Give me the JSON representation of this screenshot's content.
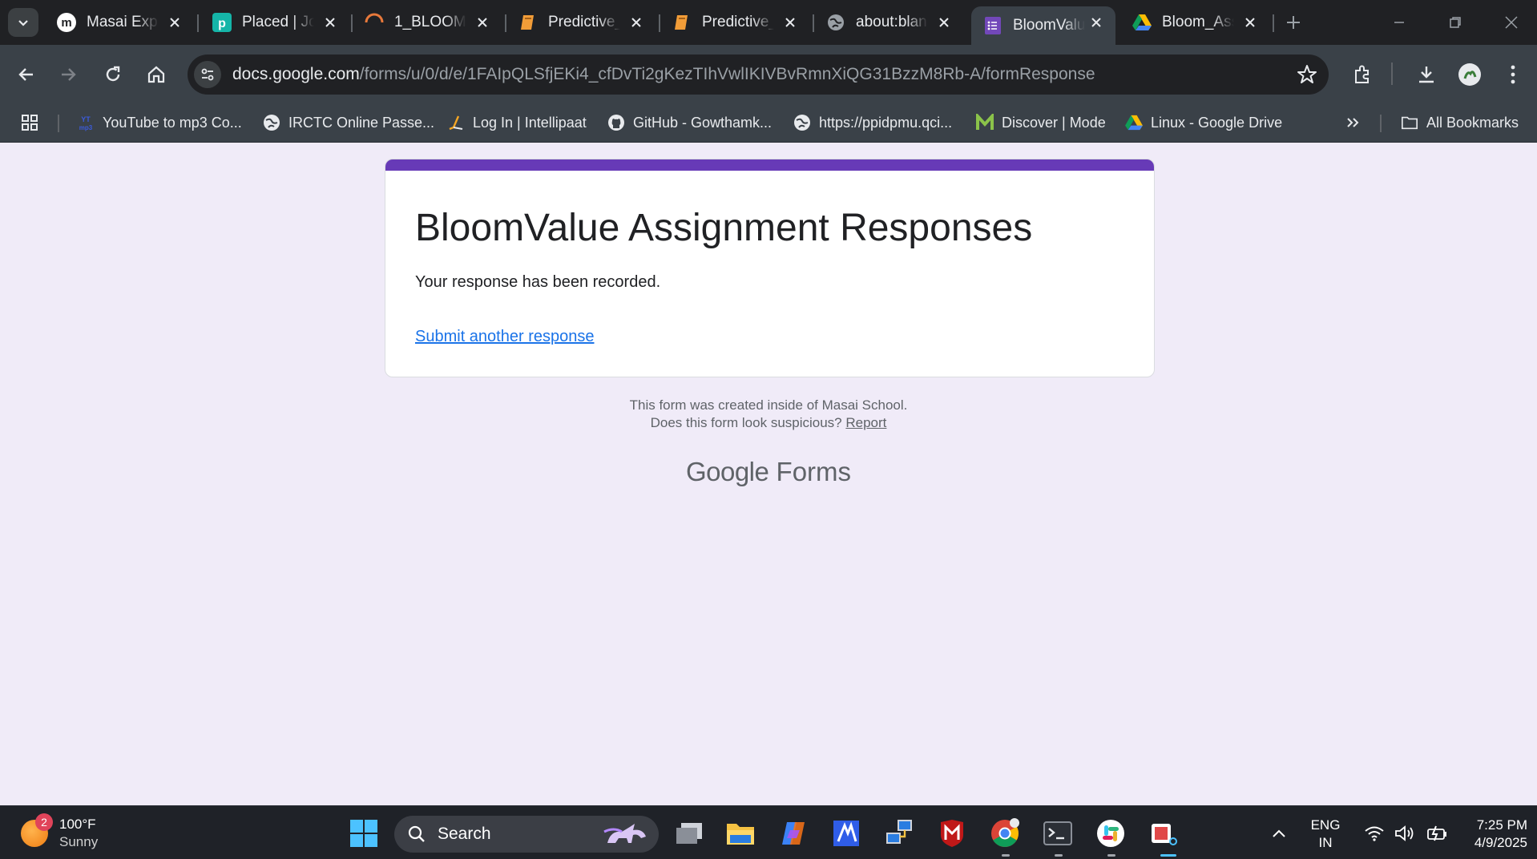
{
  "tabs": [
    {
      "title": "Masai Expe",
      "icon": "masai-icon"
    },
    {
      "title": "Placed | Jol",
      "icon": "placed-icon"
    },
    {
      "title": "1_BLOOM_",
      "icon": "loading-spinner-icon"
    },
    {
      "title": "Predictive_",
      "icon": "notebook-icon"
    },
    {
      "title": "Predictive_",
      "icon": "notebook-icon"
    },
    {
      "title": "about:blan",
      "icon": "globe-icon"
    },
    {
      "title": "BloomValu",
      "icon": "google-forms-icon",
      "active": true
    },
    {
      "title": "Bloom_Ass",
      "icon": "google-drive-icon"
    }
  ],
  "omnibox": {
    "host": "docs.google.com",
    "path": "/forms/u/0/d/e/1FAIpQLSfjEKi4_cfDvTi2gKezTIhVwlIKIVBvRmnXiQG31BzzM8Rb-A/formResponse"
  },
  "bookmarks": [
    {
      "label": "YouTube to mp3 Co...",
      "icon": "ytmp3-icon"
    },
    {
      "label": "IRCTC Online Passe...",
      "icon": "globe-icon"
    },
    {
      "label": "Log In | Intellipaat",
      "icon": "intellipaat-icon"
    },
    {
      "label": "GitHub - Gowthamk...",
      "icon": "github-icon"
    },
    {
      "label": "https://ppidpmu.qci...",
      "icon": "globe-icon"
    },
    {
      "label": "Discover | Mode",
      "icon": "mode-icon"
    },
    {
      "label": "Linux - Google Drive",
      "icon": "google-drive-icon"
    }
  ],
  "all_bookmarks": "All Bookmarks",
  "form": {
    "title": "BloomValue Assignment Responses",
    "message": "Your response has been recorded.",
    "submit_again": "Submit another response",
    "accent_color": "#673ab7",
    "footer_line1": "This form was created inside of Masai School.",
    "footer_line2": "Does this form look suspicious?",
    "report": "Report",
    "logo_google": "Google",
    "logo_forms": "Forms"
  },
  "taskbar": {
    "temperature": "100°F",
    "condition": "Sunny",
    "weather_badge": "2",
    "search_label": "Search",
    "lang_top": "ENG",
    "lang_bottom": "IN",
    "time": "7:25 PM",
    "date": "4/9/2025"
  }
}
